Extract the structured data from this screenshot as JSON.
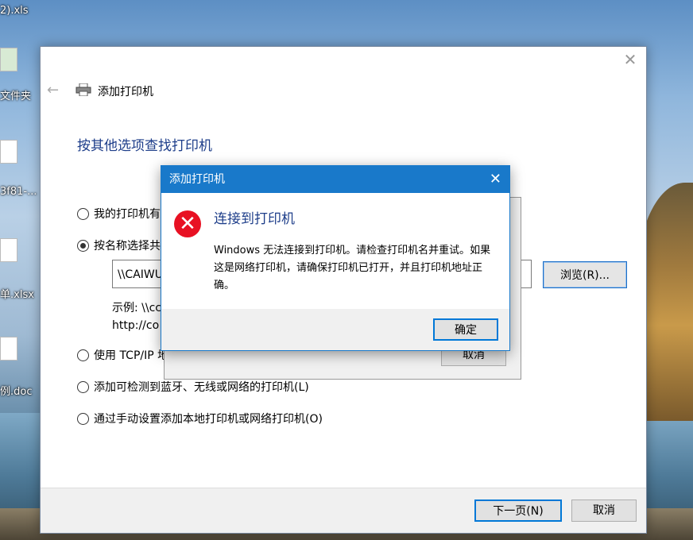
{
  "desktop": {
    "labels": [
      "2).xls",
      "文件夹",
      "3f81-...",
      "单.xlsx",
      "例.doc"
    ]
  },
  "wizard": {
    "title": "添加打印机",
    "heading": "按其他选项查找打印机",
    "options": [
      {
        "label": "我的打印机有",
        "checked": false
      },
      {
        "label": "按名称选择共",
        "checked": true
      },
      {
        "label": "使用 TCP/IP 地",
        "checked": false
      },
      {
        "label": "添加可检测到蓝牙、无线或网络的打印机(L)",
        "checked": false
      },
      {
        "label": "通过手动设置添加本地打印机或网络打印机(O)",
        "checked": false
      }
    ],
    "share_input_value": "\\\\CAIWU",
    "browse_label": "浏览(R)...",
    "example_line1": "示例: \\\\cc",
    "example_line2": "http://co",
    "next_label": "下一页(N)",
    "cancel_label": "取消"
  },
  "under_dialog": {
    "cancel_label": "取消"
  },
  "error_dialog": {
    "title": "添加打印机",
    "heading": "连接到打印机",
    "message": "Windows 无法连接到打印机。请检查打印机名并重试。如果这是网络打印机，请确保打印机已打开，并且打印机地址正确。",
    "ok_label": "确定",
    "icon": "error-icon"
  }
}
